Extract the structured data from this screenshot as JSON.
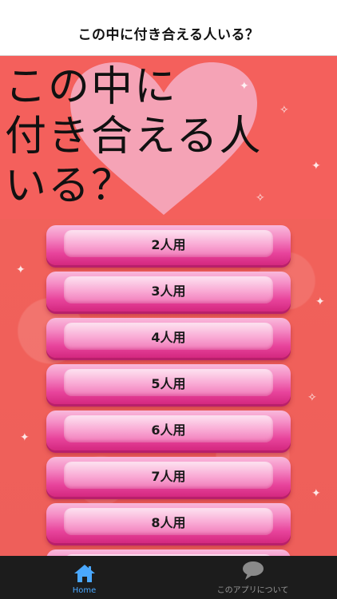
{
  "nav": {
    "title": "この中に付き合える人いる？"
  },
  "hero": {
    "text": "この中に\n付き合える人\nいる？"
  },
  "menu": [
    {
      "label": "2人用"
    },
    {
      "label": "3人用"
    },
    {
      "label": "4人用"
    },
    {
      "label": "5人用"
    },
    {
      "label": "6人用"
    },
    {
      "label": "7人用"
    },
    {
      "label": "8人用"
    }
  ],
  "tabs": [
    {
      "label": "Home",
      "icon": "home-icon",
      "active": true
    },
    {
      "label": "このアプリについて",
      "icon": "chat-bubble-icon",
      "active": false
    }
  ],
  "colors": {
    "background": "#f2625d",
    "button_pink": "#e8449c",
    "tab_active": "#4aa8ff"
  }
}
